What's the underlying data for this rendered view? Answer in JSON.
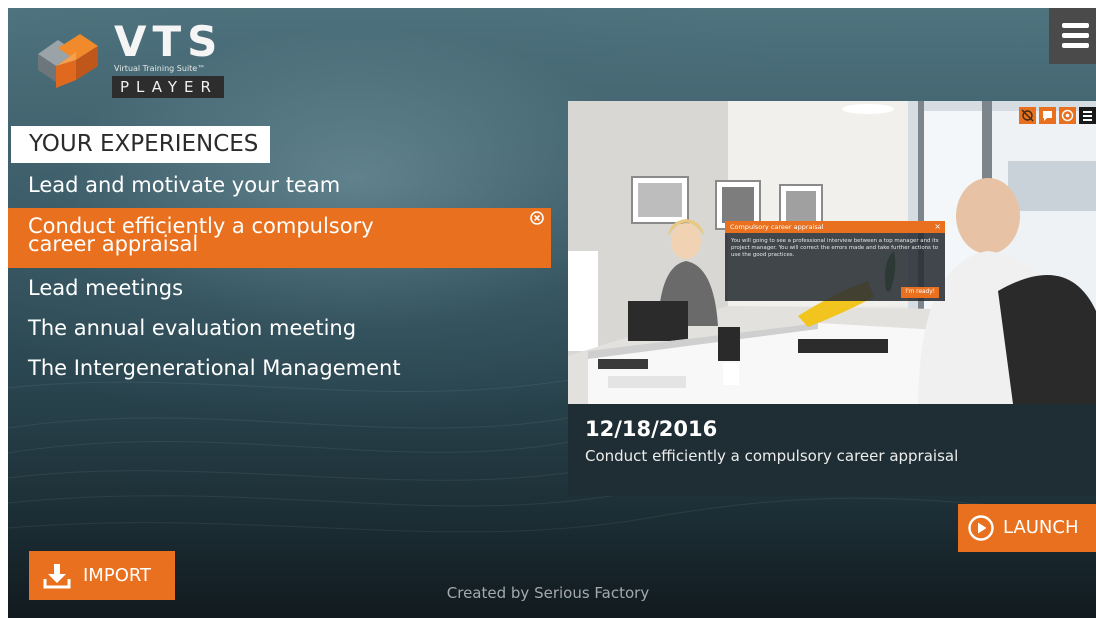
{
  "app": {
    "logo": {
      "name": "VTS",
      "subtitle": "Virtual Training Suite™",
      "product": "PLAYER"
    },
    "menu_icon": "hamburger-icon"
  },
  "experiences": {
    "header": "YOUR EXPERIENCES",
    "items": [
      {
        "label": "Lead and motivate your team",
        "selected": false
      },
      {
        "label_line1": "Conduct efficiently a compulsory",
        "label_line2": "career appraisal",
        "selected": true
      },
      {
        "label": "Lead meetings",
        "selected": false
      },
      {
        "label": "The annual evaluation meeting",
        "selected": false
      },
      {
        "label": "The Intergenerational Management",
        "selected": false
      }
    ],
    "close_icon": "circle-x-icon"
  },
  "preview": {
    "overlay_icons": [
      "eye-off-icon",
      "chat-icon",
      "target-icon",
      "menu-icon"
    ],
    "dialog": {
      "title": "Compulsory career appraisal",
      "close": "×",
      "body": "You will going to see a professional interview between a top manager and its project manager. You will correct the errors made and take further actions to use the good practices.",
      "button": "I'm ready!"
    },
    "date": "12/18/2016",
    "title": "Conduct efficiently a compulsory career appraisal"
  },
  "buttons": {
    "launch": "LAUNCH",
    "launch_icon": "play-circle-icon",
    "import": "IMPORT",
    "import_icon": "download-icon"
  },
  "footer": "Created by Serious Factory",
  "colors": {
    "accent": "#e8701e",
    "header_bg": "#ffffff",
    "menu_bg": "#4a4a4a"
  }
}
